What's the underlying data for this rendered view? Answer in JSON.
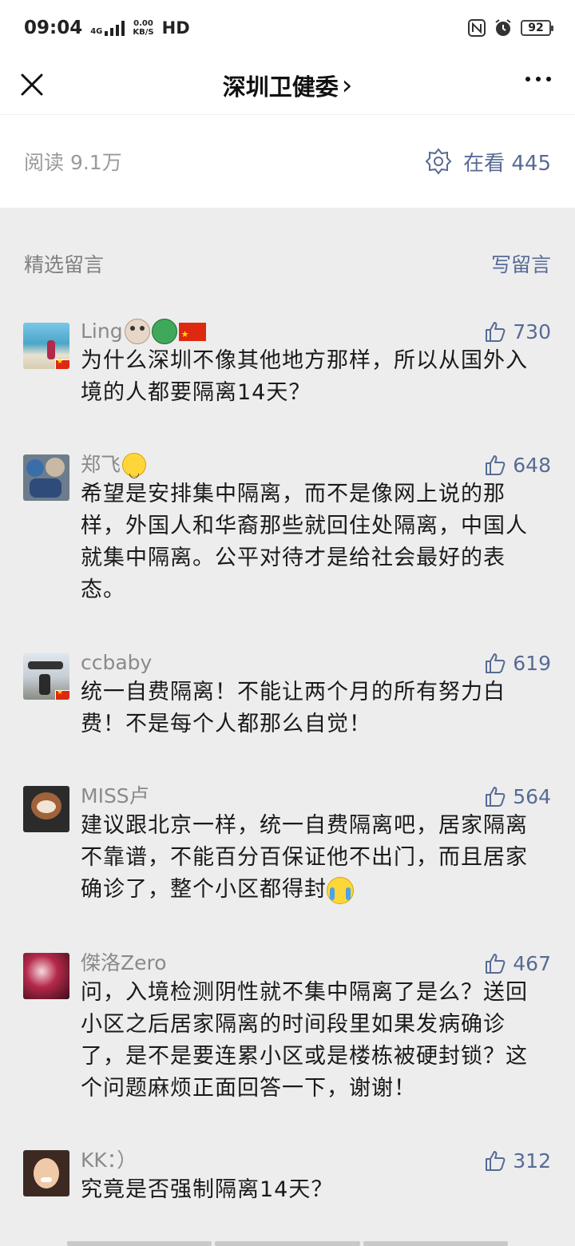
{
  "status": {
    "time": "09:04",
    "network": "4G",
    "speed_value": "0.00",
    "speed_unit": "KB/S",
    "hd": "HD",
    "battery": "92"
  },
  "nav": {
    "title": "深圳卫健委",
    "title_chevron": "›"
  },
  "stats": {
    "reads": "阅读 9.1万",
    "looking": "在看 445"
  },
  "comments_section": {
    "title": "精选留言",
    "write_label": "写留言"
  },
  "comments": [
    {
      "name": "Ling",
      "likes": "730",
      "text": "为什么深圳不像其他地方那样，所以从国外入境的人都要隔离14天？"
    },
    {
      "name": "郑飞",
      "likes": "648",
      "text": "希望是安排集中隔离，而不是像网上说的那样，外国人和华裔那些就回住处隔离，中国人就集中隔离。公平对待才是给社会最好的表态。"
    },
    {
      "name": "ccbaby",
      "likes": "619",
      "text": "统一自费隔离！不能让两个月的所有努力白费！不是每个人都那么自觉！"
    },
    {
      "name": "MISS卢",
      "likes": "564",
      "text": "建议跟北京一样，统一自费隔离吧，居家隔离不靠谱，不能百分百保证他不出门，而且居家确诊了，整个小区都得封"
    },
    {
      "name": "傑洛Zero",
      "likes": "467",
      "text": "问，入境检测阴性就不集中隔离了是么？送回小区之后居家隔离的时间段里如果发病确诊了，是不是要连累小区或是楼栋被硬封锁？这个问题麻烦正面回答一下，谢谢！"
    },
    {
      "name": "KK：）",
      "likes": "312",
      "text": "究竟是否强制隔离14天？"
    }
  ],
  "colors": {
    "link": "#576b95",
    "muted": "#8a8a8a",
    "background": "#ededed"
  }
}
